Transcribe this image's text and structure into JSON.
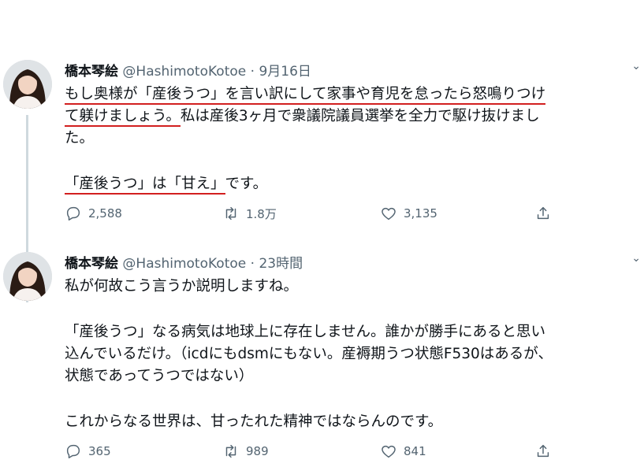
{
  "tweets": [
    {
      "name": "橋本琴絵",
      "handle": "@HashimotoKotoe",
      "dot": "·",
      "time": "9月16日",
      "lines": {
        "l1_under": "もし奥様が「産後うつ」を言い訳にして家事や育児を怠ったら怒鳴りつけ",
        "l2_under": "て躾けましょう。",
        "l2_rest": "私は産後3ヶ月で衆議院議員選挙を全力で駆け抜けまし",
        "l3": "た。",
        "l4_under": "「産後うつ」は「甘え」",
        "l4_rest": "です。"
      },
      "reply_count": "2,588",
      "retweet_count": "1.8万",
      "like_count": "3,135"
    },
    {
      "name": "橋本琴絵",
      "handle": "@HashimotoKotoe",
      "dot": "·",
      "time": "23時間",
      "lines": {
        "l1": "私が何故こう言うか説明しますね。",
        "l2": "「産後うつ」なる病気は地球上に存在しません。誰かが勝手にあると思い",
        "l3": "込んでいるだけ。（icdにもdsmにもない。産褥期うつ状態F530はあるが、",
        "l4": "状態であってうつではない）",
        "l5": "これからなる世界は、甘ったれた精神ではならんのです。"
      },
      "reply_count": "365",
      "retweet_count": "989",
      "like_count": "841"
    }
  ],
  "colors": {
    "underline": "#d21f1f",
    "secondary_text": "#536471",
    "primary_text": "#0f1419"
  },
  "icons": [
    "reply-icon",
    "retweet-icon",
    "like-icon",
    "share-icon",
    "more-icon"
  ]
}
